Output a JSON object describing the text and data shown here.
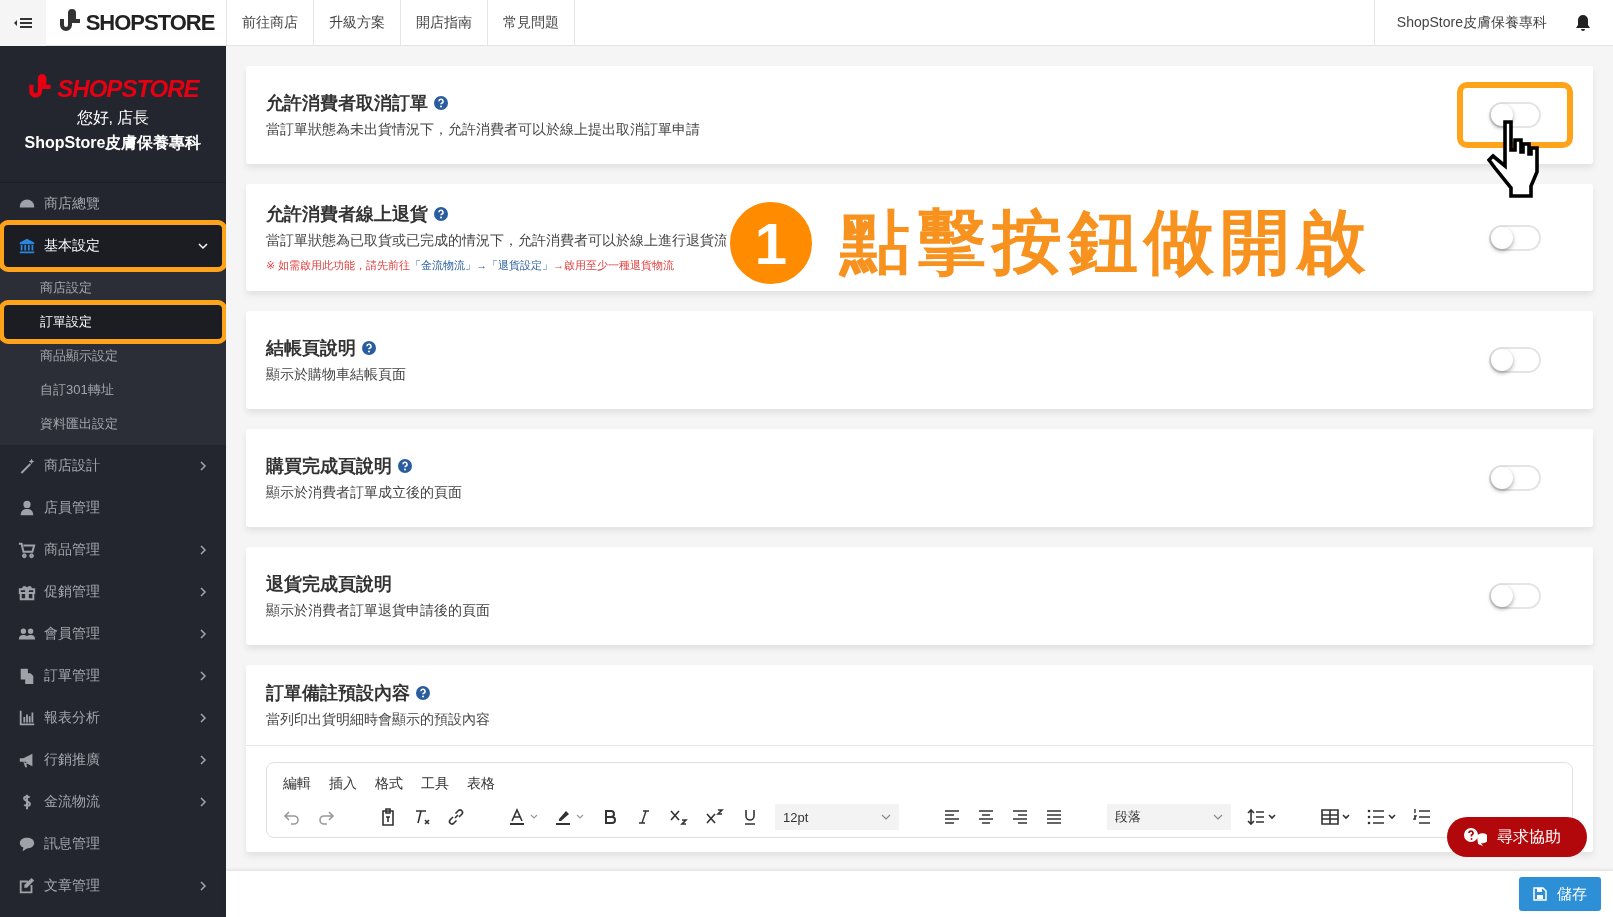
{
  "topbar": {
    "logo": "SHOPSTORE",
    "links": [
      "前往商店",
      "升級方案",
      "開店指南",
      "常見問題"
    ],
    "store_name": "ShopStore皮膚保養專科"
  },
  "sidebar": {
    "logo": "SHOPSTORE",
    "greeting": "您好, 店長",
    "store_name": "ShopStore皮膚保養專科",
    "items": [
      {
        "kind": "gauge",
        "label": "商店總覽",
        "has_submenu": false,
        "expanded": false,
        "highlighted": false
      },
      {
        "kind": "bank",
        "label": "基本設定",
        "has_submenu": true,
        "expanded": true,
        "highlighted": true,
        "children": [
          {
            "label": "商店設定",
            "selected": false,
            "highlighted": false
          },
          {
            "label": "訂單設定",
            "selected": true,
            "highlighted": true
          },
          {
            "label": "商品顯示設定",
            "selected": false,
            "highlighted": false
          },
          {
            "label": "自訂301轉址",
            "selected": false,
            "highlighted": false
          },
          {
            "label": "資料匯出設定",
            "selected": false,
            "highlighted": false
          }
        ]
      },
      {
        "kind": "wand",
        "label": "商店設計",
        "has_submenu": true,
        "expanded": false,
        "highlighted": false
      },
      {
        "kind": "person",
        "label": "店員管理",
        "has_submenu": false,
        "expanded": false,
        "highlighted": false
      },
      {
        "kind": "cart",
        "label": "商品管理",
        "has_submenu": true,
        "expanded": false,
        "highlighted": false
      },
      {
        "kind": "gift",
        "label": "促銷管理",
        "has_submenu": true,
        "expanded": false,
        "highlighted": false
      },
      {
        "kind": "people",
        "label": "會員管理",
        "has_submenu": true,
        "expanded": false,
        "highlighted": false
      },
      {
        "kind": "documents",
        "label": "訂單管理",
        "has_submenu": true,
        "expanded": false,
        "highlighted": false
      },
      {
        "kind": "chart",
        "label": "報表分析",
        "has_submenu": true,
        "expanded": false,
        "highlighted": false
      },
      {
        "kind": "megaphone",
        "label": "行銷推廣",
        "has_submenu": true,
        "expanded": false,
        "highlighted": false
      },
      {
        "kind": "dollar",
        "label": "金流物流",
        "has_submenu": true,
        "expanded": false,
        "highlighted": false
      },
      {
        "kind": "chat",
        "label": "訊息管理",
        "has_submenu": false,
        "expanded": false,
        "highlighted": false
      },
      {
        "kind": "pencil",
        "label": "文章管理",
        "has_submenu": true,
        "expanded": false,
        "highlighted": false
      }
    ]
  },
  "settings": [
    {
      "title": "允許消費者取消訂單",
      "help": true,
      "description": "當訂單狀態為未出貨情況下，允許消費者可以於線上提出取消訂單申請",
      "on": false,
      "highlighted": true
    },
    {
      "title": "允許消費者線上退貨",
      "help": true,
      "description": "當訂單狀態為已取貨或已完成的情況下，允許消費者可以於線上進行退貨流",
      "note": [
        {
          "kind": "warn",
          "text": "※ 如需啟用此功能，請先前往"
        },
        {
          "kind": "link",
          "text": "「金流物流」→「退貨設定」"
        },
        {
          "kind": "warn",
          "text": "→啟用至少一種退貨物流"
        }
      ],
      "on": false,
      "highlighted": false
    },
    {
      "title": "結帳頁說明",
      "help": true,
      "description": "顯示於購物車結帳頁面",
      "on": false,
      "highlighted": false
    },
    {
      "title": "購買完成頁說明",
      "help": true,
      "description": "顯示於消費者訂單成立後的頁面",
      "on": false,
      "highlighted": false
    },
    {
      "title": "退貨完成頁說明",
      "help": false,
      "description": "顯示於消費者訂單退貨申請後的頁面",
      "on": false,
      "highlighted": false
    }
  ],
  "default_note": {
    "title": "訂單備註預設內容",
    "help": true,
    "description": "當列印出貨明細時會顯示的預設內容",
    "editor": {
      "menu": [
        "編輯",
        "插入",
        "格式",
        "工具",
        "表格"
      ],
      "font_size": "12pt",
      "block_format": "段落"
    }
  },
  "annotation": {
    "step": "1",
    "text": "點擊按鈕做開啟"
  },
  "help_button": "尋求協助",
  "save_button": "儲存"
}
